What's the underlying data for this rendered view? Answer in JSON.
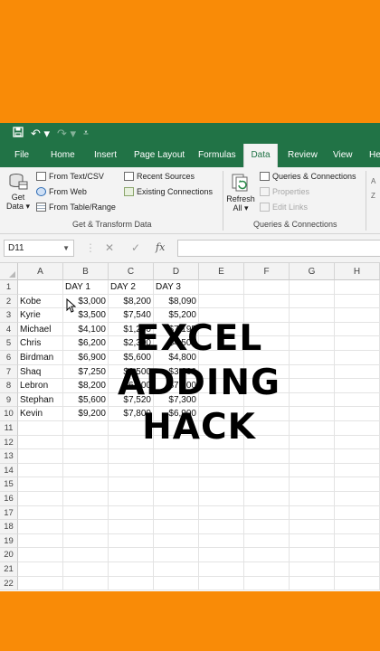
{
  "qat": {
    "save_icon": "save-icon",
    "undo_icon": "undo-icon",
    "redo_icon": "redo-icon",
    "customize_icon": "customize-icon"
  },
  "tabs": [
    "File",
    "Home",
    "Insert",
    "Page Layout",
    "Formulas",
    "Data",
    "Review",
    "View",
    "He"
  ],
  "active_tab": "Data",
  "ribbon": {
    "get_data_line1": "Get",
    "get_data_line2": "Data",
    "from_text_csv": "From Text/CSV",
    "from_web": "From Web",
    "from_table_range": "From Table/Range",
    "recent_sources": "Recent Sources",
    "existing_connections": "Existing Connections",
    "group1_label": "Get & Transform Data",
    "refresh_line1": "Refresh",
    "refresh_line2": "All",
    "queries_connections": "Queries & Connections",
    "properties": "Properties",
    "edit_links": "Edit Links",
    "group2_label": "Queries & Connections",
    "cut_off_left": "A",
    "cut_off_right": "Z"
  },
  "formula_bar": {
    "name_box": "D11",
    "cancel": "✕",
    "enter": "✓",
    "fx": "fx",
    "value": ""
  },
  "columns": [
    "A",
    "B",
    "C",
    "D",
    "E",
    "F",
    "G",
    "H"
  ],
  "rows": [
    "1",
    "2",
    "3",
    "4",
    "5",
    "6",
    "7",
    "8",
    "9",
    "10",
    "11",
    "12",
    "13",
    "14",
    "15",
    "16",
    "17",
    "18",
    "19",
    "20",
    "21",
    "22"
  ],
  "table": {
    "headers": [
      "",
      "DAY 1",
      "DAY 2",
      "DAY 3"
    ],
    "data": [
      [
        "Kobe",
        "$3,000",
        "$8,200",
        "$8,090"
      ],
      [
        "Kyrie",
        "$3,500",
        "$7,540",
        "$5,200"
      ],
      [
        "Michael",
        "$4,100",
        "$1,200",
        "$7,195"
      ],
      [
        "Chris",
        "$6,200",
        "$2,300",
        "$4,500"
      ],
      [
        "Birdman",
        "$6,900",
        "$5,600",
        "$4,800"
      ],
      [
        "Shaq",
        "$7,250",
        "$6,500",
        "$3,600"
      ],
      [
        "Lebron",
        "$8,200",
        "$6,900",
        "$7,100"
      ],
      [
        "Stephan",
        "$5,600",
        "$7,520",
        "$7,300"
      ],
      [
        "Kevin",
        "$9,200",
        "$7,800",
        "$6,900"
      ]
    ]
  },
  "overlay": {
    "line1": "EXCEL",
    "line2": "ADDING",
    "line3": "HACK"
  },
  "colors": {
    "excel_green": "#217346",
    "background_orange": "#f98b07"
  }
}
